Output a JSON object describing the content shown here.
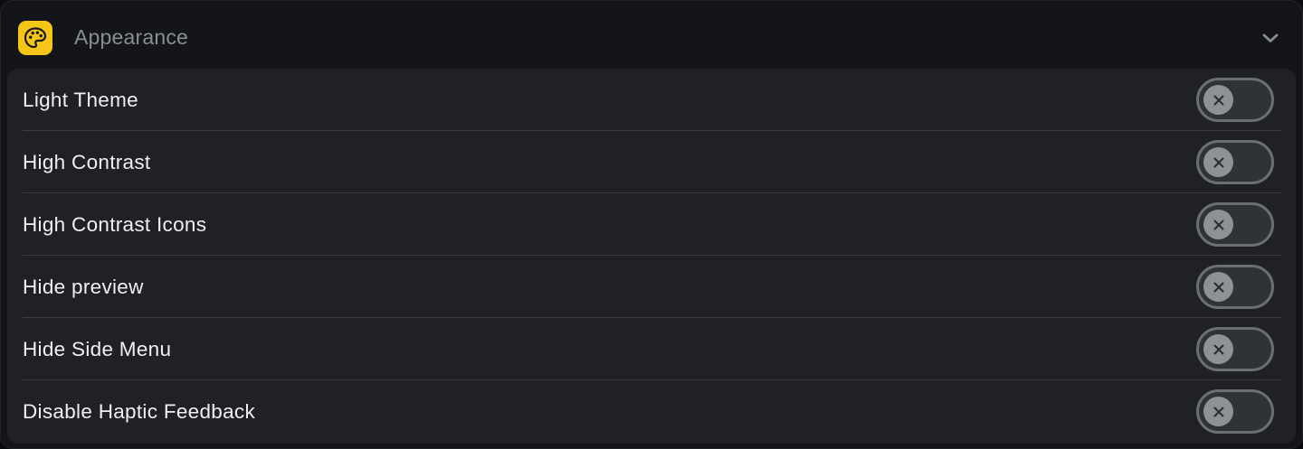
{
  "section": {
    "title": "Appearance",
    "icon": "palette-icon",
    "icon_color": "#f5c518",
    "expand_icon": "chevron-down-icon"
  },
  "settings": [
    {
      "label": "Light Theme",
      "enabled": false
    },
    {
      "label": "High Contrast",
      "enabled": false
    },
    {
      "label": "High Contrast Icons",
      "enabled": false
    },
    {
      "label": "Hide preview",
      "enabled": false
    },
    {
      "label": "Hide Side Menu",
      "enabled": false
    },
    {
      "label": "Disable Haptic Feedback",
      "enabled": false
    }
  ],
  "toggle_icon": "close-icon"
}
